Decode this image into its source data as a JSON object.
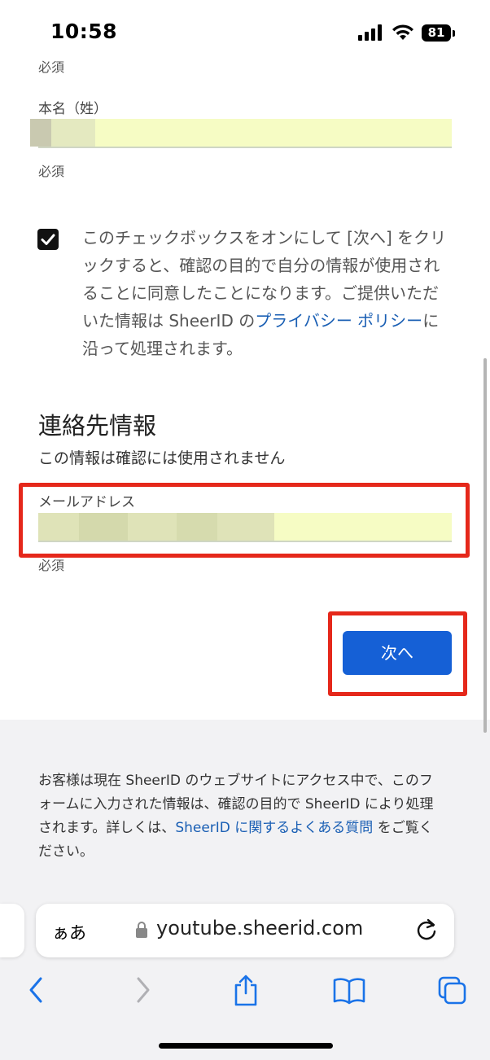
{
  "status_bar": {
    "time": "10:58",
    "battery": "81"
  },
  "form": {
    "required_top": "必須",
    "surname_label": "本名（姓）",
    "surname_required": "必須",
    "consent": {
      "checked": true,
      "text_before": "このチェックボックスをオンにして [次へ] をクリックすると、確認の目的で自分の情報が使用されることに同意したことになります。ご提供いただいた情報は SheerID の",
      "privacy_link": "プライバシー ポリシー",
      "text_after": "に沿って処理されます。"
    },
    "contact_title": "連絡先情報",
    "contact_subtitle": "この情報は確認には使用されません",
    "email_label": "メールアドレス",
    "email_required": "必須",
    "next_button": "次へ"
  },
  "footer": {
    "text_before": "お客様は現在 SheerID のウェブサイトにアクセス中で、このフォームに入力された情報は、確認の目的で SheerID により処理されます。詳しくは、",
    "faq_link": "SheerID に関するよくある質問",
    "text_after": "をご覧ください。"
  },
  "browser": {
    "text_size_button": "ぁあ",
    "url": "youtube.sheerid.com"
  },
  "colors": {
    "accent": "#1560d6",
    "highlight_box": "#e5281b",
    "input_fill": "#f6fcc4"
  }
}
